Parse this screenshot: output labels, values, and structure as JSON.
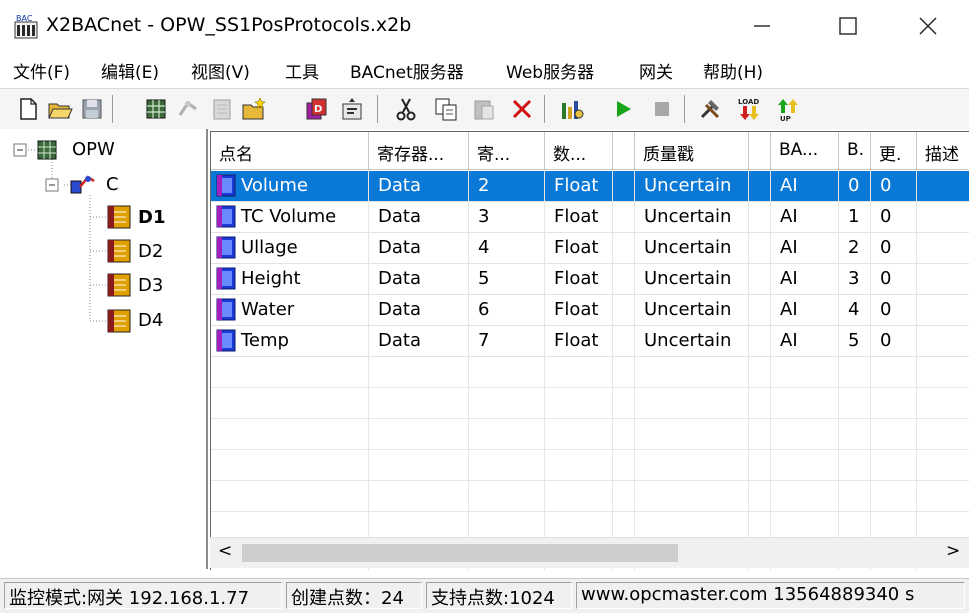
{
  "window": {
    "title": "X2BACnet - OPW_SS1PosProtocols.x2b",
    "app_icon_text": "BAC"
  },
  "menu": [
    "文件(F)",
    "编辑(E)",
    "视图(V)",
    "工具",
    "BACnet服务器",
    "Web服务器",
    "网关",
    "帮助(H)"
  ],
  "toolbar": {
    "icons": [
      "new-file-icon",
      "open-folder-icon",
      "save-icon",
      "grid-icon",
      "channel-icon",
      "device-icon",
      "add-folder-icon",
      "add-tag-icon",
      "properties-icon",
      "cut-icon",
      "copy-icon",
      "paste-icon",
      "delete-icon",
      "monitor-icon",
      "play-icon",
      "stop-icon",
      "tools-icon",
      "load-icon",
      "up-icon"
    ],
    "load_text": "LOAD",
    "up_text": "UP"
  },
  "tree": {
    "root": "OPW",
    "channel": "C",
    "devices": [
      "D1",
      "D2",
      "D3",
      "D4"
    ],
    "selected": "D1"
  },
  "grid": {
    "columns": [
      "点名",
      "寄存器...",
      "寄...",
      "数...",
      "",
      "质量戳",
      "",
      "BA...",
      "B.",
      "更.",
      "描述"
    ],
    "rows": [
      [
        "Volume",
        "Data",
        "2",
        "Float",
        "Uncertain",
        "AI",
        "0",
        "0"
      ],
      [
        "TC Volume",
        "Data",
        "3",
        "Float",
        "Uncertain",
        "AI",
        "1",
        "0"
      ],
      [
        "Ullage",
        "Data",
        "4",
        "Float",
        "Uncertain",
        "AI",
        "2",
        "0"
      ],
      [
        "Height",
        "Data",
        "5",
        "Float",
        "Uncertain",
        "AI",
        "3",
        "0"
      ],
      [
        "Water",
        "Data",
        "6",
        "Float",
        "Uncertain",
        "AI",
        "4",
        "0"
      ],
      [
        "Temp",
        "Data",
        "7",
        "Float",
        "Uncertain",
        "AI",
        "5",
        "0"
      ]
    ],
    "selected_row": 0
  },
  "scrollbar": {
    "left": "<",
    "right": ">"
  },
  "status": {
    "mode": "监控模式:网关 192.168.1.77",
    "created": "创建点数：24",
    "supported": "支持点数:1024",
    "contact": "www.opcmaster.com 13564889340 s"
  },
  "colors": {
    "selection": "#0a78d7",
    "play": "#1aa51a",
    "delete": "#d01010"
  }
}
